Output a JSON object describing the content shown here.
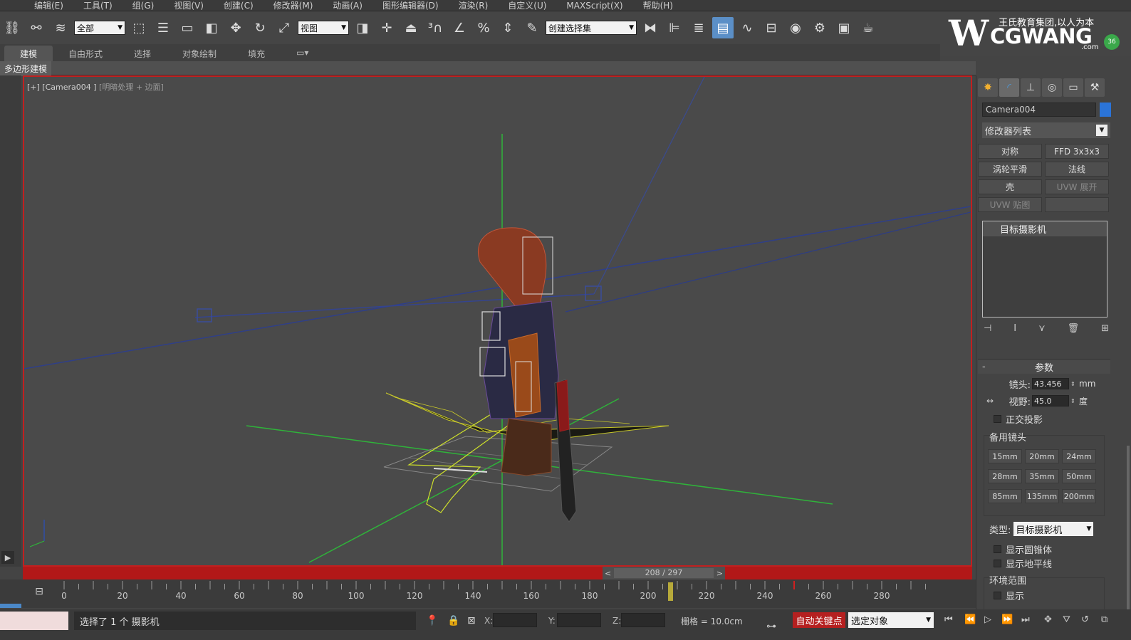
{
  "menu": [
    "编辑(E)",
    "工具(T)",
    "组(G)",
    "视图(V)",
    "创建(C)",
    "修改器(M)",
    "动画(A)",
    "图形编辑器(D)",
    "渲染(R)",
    "自定义(U)",
    "MAXScript(X)",
    "帮助(H)"
  ],
  "toolbar": {
    "filter_select": "全部",
    "ref_coord_select": "视图",
    "selection_set_select": "创建选择集"
  },
  "logo": {
    "tagline": "王氏教育集团,以人为本",
    "brand": "CGWANG",
    "suffix": ".com",
    "badge": "36"
  },
  "ribbon": {
    "tabs": [
      "建模",
      "自由形式",
      "选择",
      "对象绘制",
      "填充"
    ],
    "sub_label": "多边形建模"
  },
  "viewport": {
    "label_main": "[+] [Camera004 ]",
    "label_dim": "[明暗处理 + 边面]"
  },
  "timeline": {
    "frame_display": "208 / 297",
    "prev": "<",
    "next": ">",
    "ticks": [
      "0",
      "20",
      "40",
      "60",
      "80",
      "100",
      "120",
      "140",
      "160",
      "180",
      "200",
      "220",
      "240",
      "260",
      "280"
    ]
  },
  "command_panel": {
    "object_name": "Camera004",
    "object_color": "#2b74d8",
    "modifier_list": "修改器列表",
    "modifier_buttons": [
      {
        "label": "对称",
        "dim": false
      },
      {
        "label": "FFD 3x3x3",
        "dim": false
      },
      {
        "label": "涡轮平滑",
        "dim": false
      },
      {
        "label": "法线",
        "dim": false
      },
      {
        "label": "壳",
        "dim": false
      },
      {
        "label": "UVW 展开",
        "dim": true
      },
      {
        "label": "UVW 贴图",
        "dim": true
      },
      {
        "label": "",
        "dim": true
      }
    ],
    "stack_item": "目标摄影机",
    "params_title": "参数",
    "lens_label": "镜头:",
    "lens_value": "43.456",
    "lens_unit": "mm",
    "fov_label": "视野:",
    "fov_value": "45.0",
    "fov_unit": "度",
    "ortho_label": "正交投影",
    "stock_lens_label": "备用镜头",
    "stock_lenses": [
      "15mm",
      "20mm",
      "24mm",
      "28mm",
      "35mm",
      "50mm",
      "85mm",
      "135mm",
      "200mm"
    ],
    "type_label": "类型:",
    "type_value": "目标摄影机",
    "show_cone_label": "显示圆锥体",
    "show_horizon_label": "显示地平线",
    "env_range_label": "环境范围",
    "show_label": "显示"
  },
  "status": {
    "message": "选择了 1 个 摄影机",
    "x_label": "X:",
    "y_label": "Y:",
    "z_label": "Z:",
    "grid": "栅格 = 10.0cm",
    "auto_key": "自动关键点",
    "selection_filter": "选定对象"
  }
}
